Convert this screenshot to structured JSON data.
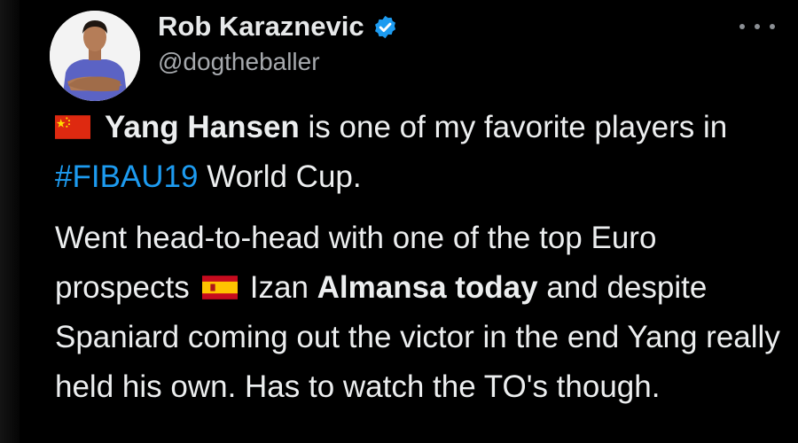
{
  "author": {
    "display_name": "Rob Karaznevic",
    "handle": "@dogtheballer",
    "verified": true,
    "avatar_icon": "profile-photo-avatar",
    "verified_icon": "verified-badge-icon",
    "verified_color": "#1d9bf0"
  },
  "actions": {
    "more_icon": "more-options-icon"
  },
  "tweet": {
    "p1": {
      "flag_icon": "china-flag-icon",
      "t1": "Yang Hansen",
      "t2": " is one of my favorite players in ",
      "hashtag": "#FIBAU19",
      "t3": " World Cup."
    },
    "p2": {
      "t1": "Went head-to-head with one of the top Euro prospects",
      "flag_icon": "spain-flag-icon",
      "t2": "Izan ",
      "t3": "Almansa today",
      "t4": " and despite Spaniard coming out the victor in the end Yang really held his own. Has to watch the TO's though."
    }
  },
  "colors": {
    "background": "#000000",
    "text": "#e7e9ea",
    "muted": "#a6a9ad",
    "link": "#1d9bf0"
  }
}
